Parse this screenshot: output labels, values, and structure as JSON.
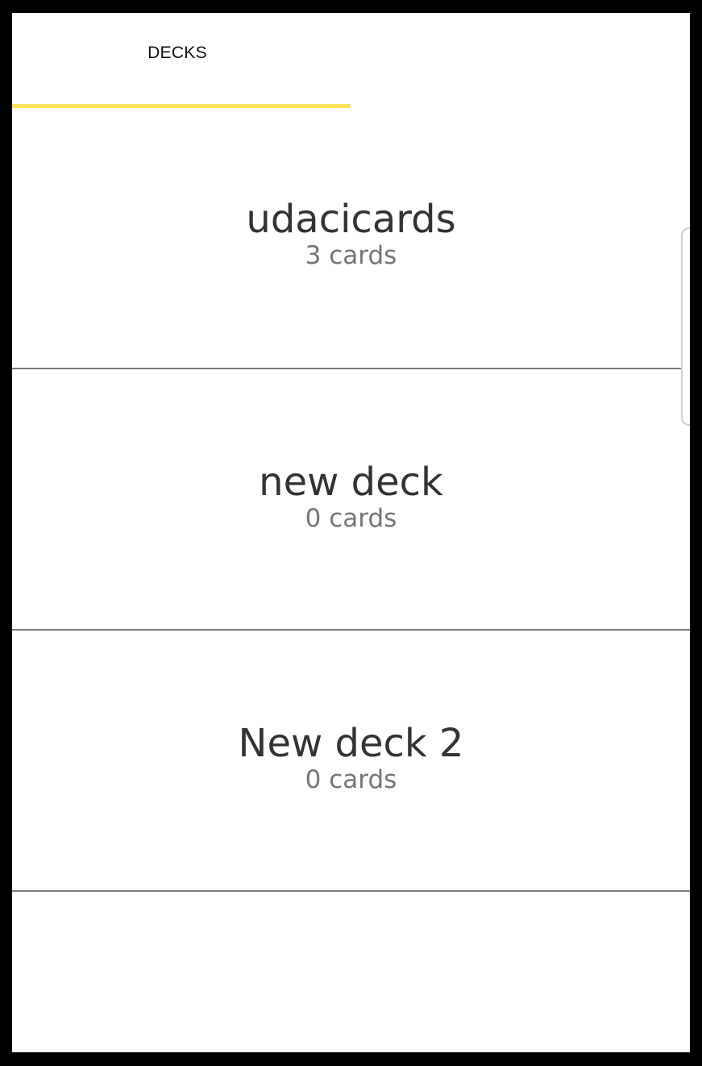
{
  "tabs": [
    {
      "label": "DECKS",
      "active": true
    }
  ],
  "colors": {
    "tab_indicator": "#fde25e",
    "divider": "#7a7a7a",
    "title_text": "#333333",
    "count_text": "#757575"
  },
  "decks": [
    {
      "title": "udacicards",
      "count_label": "3 cards"
    },
    {
      "title": "new deck",
      "count_label": "0 cards"
    },
    {
      "title": "New deck 2",
      "count_label": "0 cards"
    }
  ]
}
